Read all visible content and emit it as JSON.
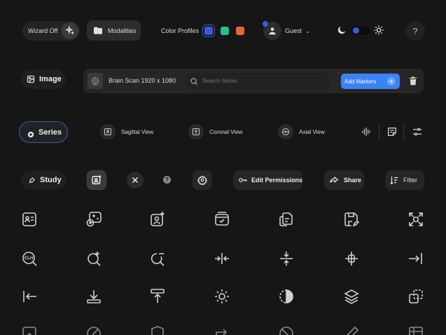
{
  "toolbar1": {
    "wizard_label": "Wizard Off",
    "modalities_label": "Modalities",
    "color_profiles_label": "Color Profiles",
    "swatches": [
      "#3a5bd9",
      "#22c08a",
      "#e8663c"
    ],
    "user_label": "Guest",
    "help_glyph": "?"
  },
  "toolbar2": {
    "image_label": "Image",
    "file_label": "Brain Scan 1920 x 1080",
    "search_placeholder": "Search Series",
    "add_markers_label": "Add Markers"
  },
  "toolbar3": {
    "series_label": "Series",
    "sagittal_label": "Sagittal View",
    "coronal_label": "Coronal View",
    "axial_label": "Axial View"
  },
  "toolbar4": {
    "study_label": "Study",
    "edit_permissions_label": "Edit Permissions",
    "share_label": "Share",
    "filter_label": "Filter"
  },
  "colors": {
    "accent": "#3b82f6",
    "background": "#161616"
  }
}
